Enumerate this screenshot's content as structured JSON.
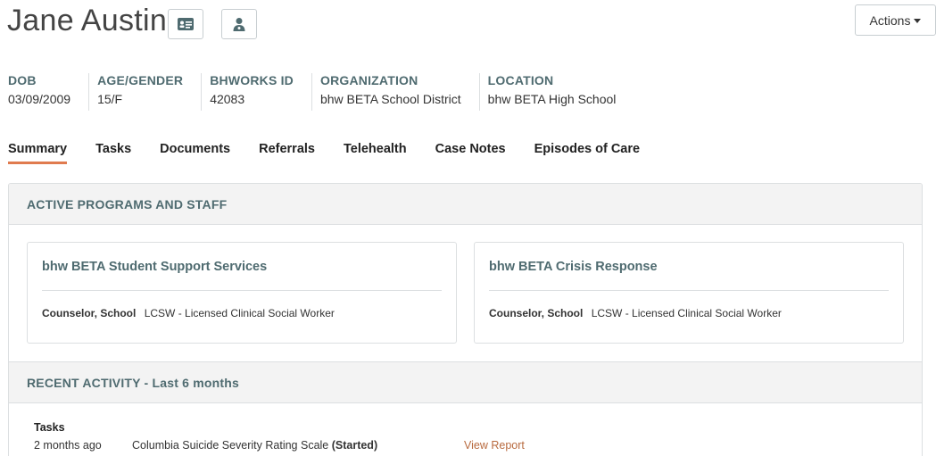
{
  "patient": {
    "name": "Jane Austin"
  },
  "header": {
    "actions_label": "Actions"
  },
  "demographics": [
    {
      "label": "DOB",
      "value": "03/09/2009"
    },
    {
      "label": "AGE/GENDER",
      "value": "15/F"
    },
    {
      "label": "BHWORKS ID",
      "value": "42083"
    },
    {
      "label": "ORGANIZATION",
      "value": "bhw BETA School District"
    },
    {
      "label": "LOCATION",
      "value": "bhw BETA High School"
    }
  ],
  "tabs": [
    {
      "label": "Summary",
      "active": true
    },
    {
      "label": "Tasks"
    },
    {
      "label": "Documents"
    },
    {
      "label": "Referrals"
    },
    {
      "label": "Telehealth"
    },
    {
      "label": "Case Notes"
    },
    {
      "label": "Episodes of Care"
    }
  ],
  "programs_section": {
    "title": "ACTIVE PROGRAMS AND STAFF",
    "programs": [
      {
        "name": "bhw BETA Student Support Services",
        "role": "Counselor, School",
        "staff": "LCSW - Licensed Clinical Social Worker"
      },
      {
        "name": "bhw BETA Crisis Response",
        "role": "Counselor, School",
        "staff": "LCSW - Licensed Clinical Social Worker"
      }
    ]
  },
  "activity_section": {
    "title": "RECENT ACTIVITY - Last 6 months",
    "group_label": "Tasks",
    "items": [
      {
        "when": "2 months ago",
        "name": "Columbia Suicide Severity Rating Scale",
        "status": "(Started)",
        "link": "View Report"
      }
    ]
  },
  "colors": {
    "accent": "#e07b4f",
    "heading": "#4f6b70",
    "link": "#b86a3f"
  }
}
